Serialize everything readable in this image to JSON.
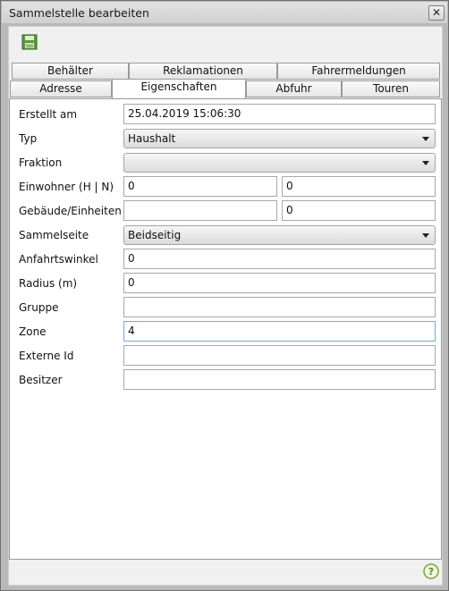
{
  "window": {
    "title": "Sammelstelle bearbeiten",
    "close_glyph": "✕"
  },
  "toolbar": {
    "save_icon": "save-icon"
  },
  "tabs_row1": [
    {
      "label": "Behälter"
    },
    {
      "label": "Reklamationen"
    },
    {
      "label": "Fahrermeldungen"
    }
  ],
  "tabs_row2": [
    {
      "label": "Adresse"
    },
    {
      "label": "Eigenschaften"
    },
    {
      "label": "Abfuhr"
    },
    {
      "label": "Touren"
    }
  ],
  "form": {
    "erstellt_label": "Erstellt am",
    "erstellt_value": "25.04.2019 15:06:30",
    "typ_label": "Typ",
    "typ_value": "Haushalt",
    "fraktion_label": "Fraktion",
    "fraktion_value": "",
    "einwohner_label": "Einwohner (H | N)",
    "einwohner_h": "0",
    "einwohner_n": "0",
    "gebaeude_label": "Gebäude/Einheiten",
    "gebaeude_value": "",
    "einheiten_value": "0",
    "sammelseite_label": "Sammelseite",
    "sammelseite_value": "Beidseitig",
    "anfahrtswinkel_label": "Anfahrtswinkel",
    "anfahrtswinkel_value": "0",
    "radius_label": "Radius (m)",
    "radius_value": "0",
    "gruppe_label": "Gruppe",
    "gruppe_value": "",
    "zone_label": "Zone",
    "zone_value": "4",
    "externe_id_label": "Externe Id",
    "externe_id_value": "",
    "besitzer_label": "Besitzer",
    "besitzer_value": ""
  },
  "footer": {
    "help_icon": "help-icon",
    "help_glyph": "?"
  },
  "colors": {
    "window_frame": "#b9b9b9",
    "content_bg": "#f0f0f0",
    "help_green": "#7aa63a",
    "save_green": "#4a8a2a"
  }
}
